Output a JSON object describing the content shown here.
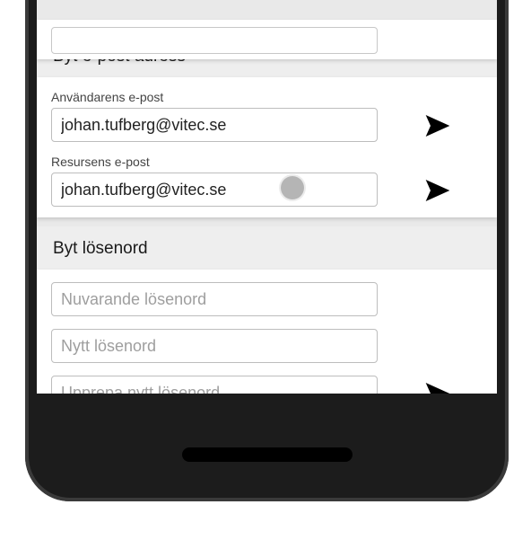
{
  "email_section": {
    "header": "Byt e-post adress",
    "user": {
      "label": "Användarens e-post",
      "value": "johan.tufberg@vitec.se"
    },
    "resource": {
      "label": "Resursens e-post",
      "value": "johan.tufberg@vitec.se"
    }
  },
  "password_section": {
    "header": "Byt lösenord",
    "current_placeholder": "Nuvarande lösenord",
    "new_placeholder": "Nytt lösenord",
    "repeat_placeholder": "Upprepa nytt lösenord"
  }
}
